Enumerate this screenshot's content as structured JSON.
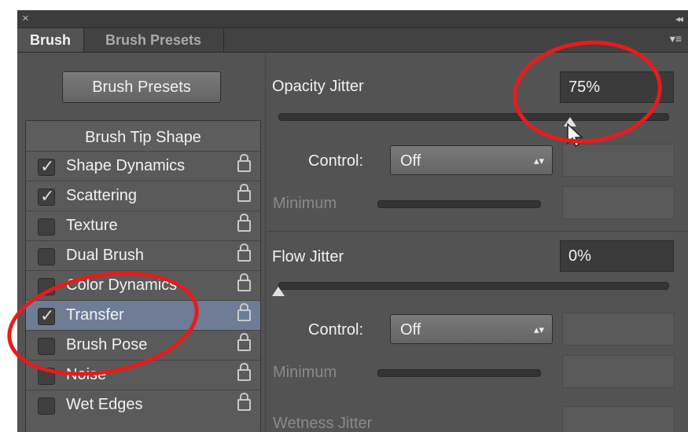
{
  "window": {
    "close_glyph": "×",
    "collapse_glyph": "◂◂"
  },
  "tabs": [
    {
      "label": "Brush"
    },
    {
      "label": "Brush Presets"
    }
  ],
  "panel_menu_glyph": "▾≡",
  "presets_button": "Brush Presets",
  "list": {
    "header": "Brush Tip Shape",
    "items": [
      {
        "label": "Shape Dynamics",
        "checked": true
      },
      {
        "label": "Scattering",
        "checked": true
      },
      {
        "label": "Texture",
        "checked": false
      },
      {
        "label": "Dual Brush",
        "checked": false
      },
      {
        "label": "Color Dynamics",
        "checked": false
      },
      {
        "label": "Transfer",
        "checked": true,
        "selected": true
      },
      {
        "label": "Brush Pose",
        "checked": false
      },
      {
        "label": "Noise",
        "checked": false
      },
      {
        "label": "Wet Edges",
        "checked": false
      }
    ]
  },
  "opacity": {
    "label": "Opacity Jitter",
    "value": "75%",
    "slider_fraction": 0.75,
    "control_label": "Control:",
    "control_value": "Off",
    "minimum_label": "Minimum"
  },
  "flow": {
    "label": "Flow Jitter",
    "value": "0%",
    "slider_fraction": 0,
    "control_label": "Control:",
    "control_value": "Off",
    "minimum_label": "Minimum"
  },
  "wetness": {
    "label": "Wetness Jitter"
  },
  "colors": {
    "annotation": "#e81b1b",
    "selected_row": "#6e7c96",
    "panel": "#535353"
  }
}
